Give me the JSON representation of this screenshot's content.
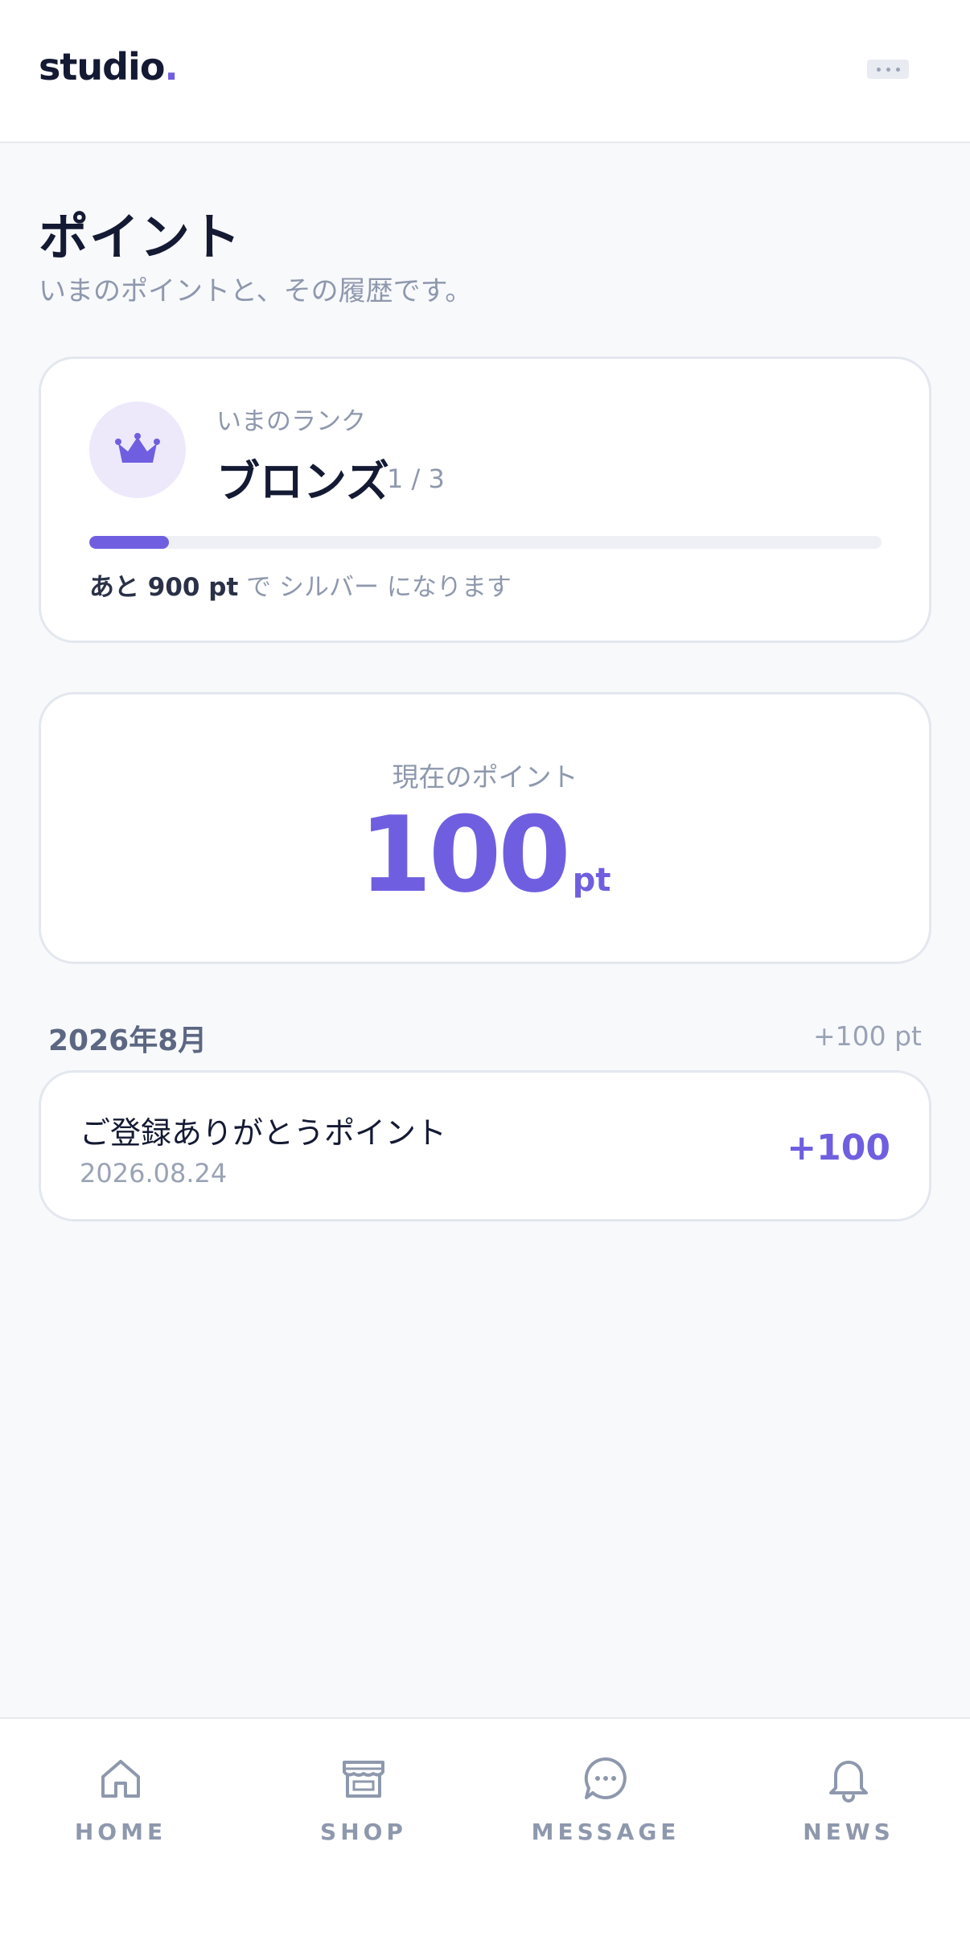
{
  "header": {
    "logo_text": "studio",
    "logo_dot": ".",
    "menu_icon": "more-dots-icon"
  },
  "page": {
    "title": "ポイント",
    "subtitle": "いまのポイントと、その履歴です。"
  },
  "rank": {
    "label": "いまのランク",
    "name": "ブロンズ",
    "step": "1 / 3",
    "progress": 0.1,
    "note_strong": "あと 900 pt",
    "note_text": " で シルバー になります",
    "icon": "crown-icon"
  },
  "points": {
    "label": "現在のポイント",
    "value": "100",
    "unit": "pt"
  },
  "history": {
    "month": "2026年8月",
    "month_total": "+100 pt",
    "items": [
      {
        "title": "ご登録ありがとうポイント",
        "date": "2026.08.24",
        "amount": "+100"
      }
    ]
  },
  "nav": {
    "items": [
      {
        "label": "HOME",
        "icon": "home-icon"
      },
      {
        "label": "SHOP",
        "icon": "shop-icon"
      },
      {
        "label": "MESSAGE",
        "icon": "message-icon"
      },
      {
        "label": "NEWS",
        "icon": "bell-icon"
      }
    ]
  },
  "colors": {
    "accent": "#6f5fe0",
    "accent_light": "#ede9fb",
    "text_primary": "#141a33",
    "text_muted": "#8e98ad",
    "background": "#f8f9fb"
  }
}
